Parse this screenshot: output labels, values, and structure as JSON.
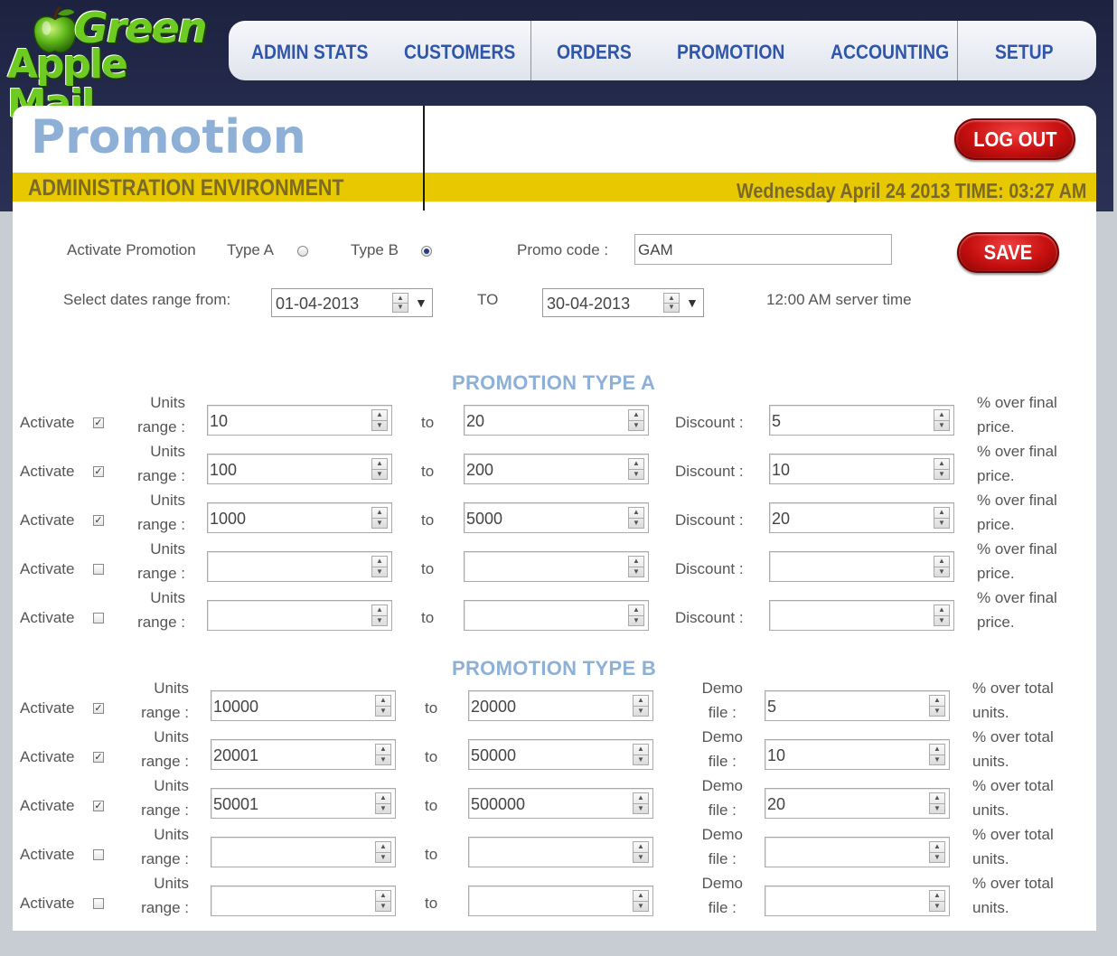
{
  "logo": {
    "line1": "Green",
    "line2": "Apple Mail"
  },
  "nav": {
    "items": [
      "ADMIN STATS",
      "CUSTOMERS",
      "ORDERS",
      "PROMOTION",
      "ACCOUNTING",
      "SETUP"
    ]
  },
  "header": {
    "title": "Promotion",
    "subtitle": "ADMINISTRATION ENVIRONMENT",
    "datetime": "Wednesday April 24 2013 TIME: 03:27 AM",
    "logout_label": "LOG OUT"
  },
  "settings": {
    "activate_label": "Activate Promotion",
    "type_a_label": "Type A",
    "type_b_label": "Type B",
    "selected_type": "Type B",
    "promo_label": "Promo code :",
    "promo_value": "GAM",
    "save_label": "SAVE",
    "dates_label": "Select dates range from:",
    "date_from": "01-04-2013",
    "to_label": "TO",
    "date_to": "30-04-2013",
    "server_time": "12:00 AM server time"
  },
  "typeA": {
    "title": "PROMOTION TYPE A",
    "labels": {
      "activate": "Activate",
      "units1": "Units",
      "units2": "range :",
      "to": "to",
      "discount": "Discount :",
      "suffix1": "% over final",
      "suffix2": "price."
    },
    "rows": [
      {
        "checked": true,
        "from": "10",
        "to": "20",
        "value": "5"
      },
      {
        "checked": true,
        "from": "100",
        "to": "200",
        "value": "10"
      },
      {
        "checked": true,
        "from": "1000",
        "to": "5000",
        "value": "20"
      },
      {
        "checked": false,
        "from": "",
        "to": "",
        "value": ""
      },
      {
        "checked": false,
        "from": "",
        "to": "",
        "value": ""
      }
    ]
  },
  "typeB": {
    "title": "PROMOTION TYPE B",
    "labels": {
      "activate": "Activate",
      "units1": "Units",
      "units2": "range :",
      "to": "to",
      "demo1": "Demo",
      "demo2": "file :",
      "suffix1": "% over total",
      "suffix2": "units."
    },
    "rows": [
      {
        "checked": true,
        "from": "10000",
        "to": "20000",
        "value": "5"
      },
      {
        "checked": true,
        "from": "20001",
        "to": "50000",
        "value": "10"
      },
      {
        "checked": true,
        "from": "50001",
        "to": "500000",
        "value": "20"
      },
      {
        "checked": false,
        "from": "",
        "to": "",
        "value": ""
      },
      {
        "checked": false,
        "from": "",
        "to": "",
        "value": ""
      }
    ]
  },
  "colors": {
    "accent_blue": "#2f56a8",
    "title_blue": "#8fb0d6",
    "band_yellow": "#e8c800",
    "button_red": "#c81010",
    "logo_green": "#6ecb22"
  }
}
